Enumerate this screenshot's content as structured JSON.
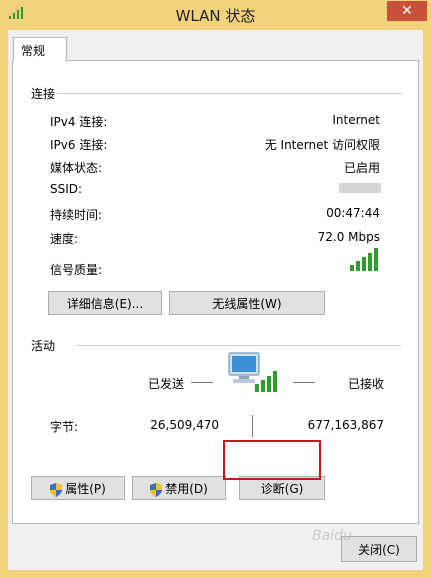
{
  "window": {
    "title": "WLAN 状态",
    "close_glyph": "✕"
  },
  "tabs": [
    {
      "label": "常规"
    }
  ],
  "connection": {
    "section_label": "连接",
    "rows": [
      {
        "label": "IPv4 连接:",
        "value": "Internet"
      },
      {
        "label": "IPv6 连接:",
        "value": "无 Internet 访问权限"
      },
      {
        "label": "媒体状态:",
        "value": "已启用"
      },
      {
        "label": "SSID:",
        "value": ""
      },
      {
        "label": "持续时间:",
        "value": "00:47:44"
      },
      {
        "label": "速度:",
        "value": "72.0 Mbps"
      }
    ],
    "signal_label": "信号质量:",
    "signal_icon": "signal-bars-icon",
    "details_button": "详细信息(E)...",
    "wireless_props_button": "无线属性(W)"
  },
  "activity": {
    "section_label": "活动",
    "sent_label": "已发送",
    "received_label": "已接收",
    "bytes_label": "字节:",
    "bytes_sent": "26,509,470",
    "bytes_received": "677,163,867",
    "network_icon": "network-computer-icon"
  },
  "actions": {
    "properties_button": "属性(P)",
    "disable_button": "禁用(D)",
    "diagnose_button": "诊断(G)",
    "close_button": "关闭(C)"
  },
  "watermark": "Baidu",
  "colors": {
    "highlight_border": "#c8161d",
    "signal_green": "#2e9d2e",
    "titlebar_bg": "#f3d27e",
    "close_bg": "#c7513b"
  }
}
